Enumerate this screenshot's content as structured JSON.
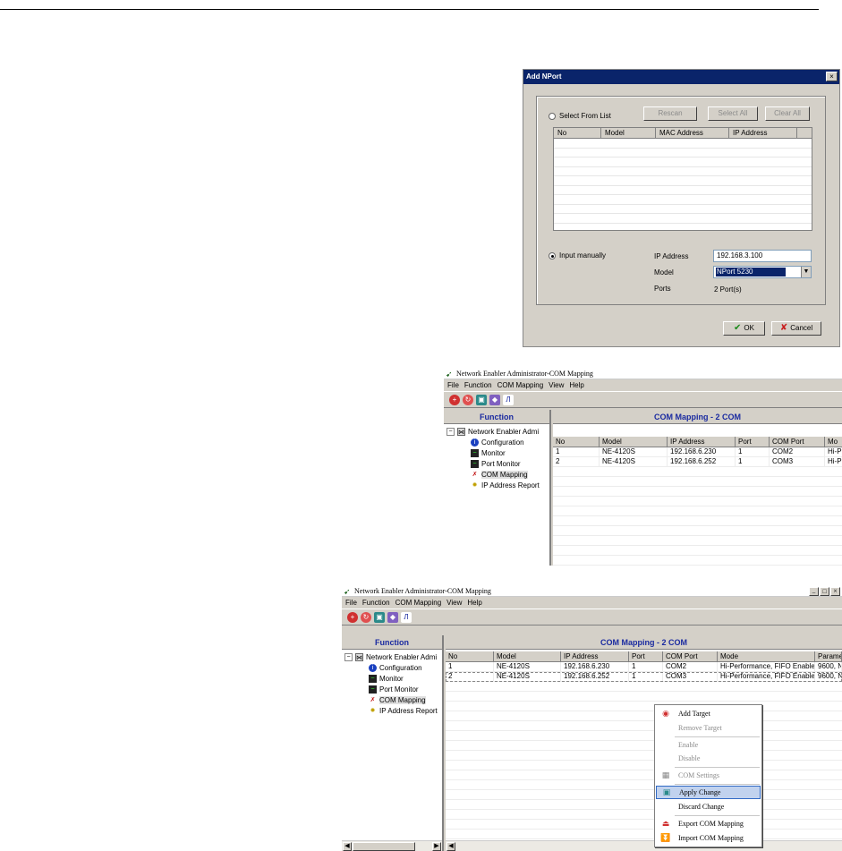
{
  "dialog": {
    "title": "Add NPort",
    "close": "×",
    "select_from_list": "Select From List",
    "rescan": "Rescan",
    "select_all": "Select All",
    "clear_all": "Clear All",
    "columns": [
      "No",
      "Model",
      "MAC Address",
      "IP Address"
    ],
    "input_manually": "Input manually",
    "ip_label": "IP Address",
    "ip_value": "192.168.3.100",
    "model_label": "Model",
    "model_value": "NPort 5230",
    "ports_label": "Ports",
    "ports_value": "2 Port(s)",
    "ok": "OK",
    "cancel": "Cancel"
  },
  "window1": {
    "title": "Network Enabler Administrator-COM Mapping",
    "menu": [
      "File",
      "Function",
      "COM Mapping",
      "View",
      "Help"
    ],
    "function_header": "Function",
    "tree_root": "Network Enabler Admi",
    "tree_items": [
      "Configuration",
      "Monitor",
      "Port Monitor",
      "COM Mapping",
      "IP Address Report"
    ],
    "content_header": "COM Mapping - 2 COM",
    "columns": [
      "No",
      "Model",
      "IP Address",
      "Port",
      "COM Port",
      "Mo"
    ],
    "rows": [
      [
        "1",
        "NE-4120S",
        "192.168.6.230",
        "1",
        "COM2",
        "Hi-P"
      ],
      [
        "2",
        "NE-4120S",
        "192.168.6.252",
        "1",
        "COM3",
        "Hi-P"
      ]
    ]
  },
  "window2": {
    "title": "Network Enabler Administrator-COM Mapping",
    "menu": [
      "File",
      "Function",
      "COM Mapping",
      "View",
      "Help"
    ],
    "function_header": "Function",
    "tree_root": "Network Enabler Admi",
    "tree_items": [
      "Configuration",
      "Monitor",
      "Port Monitor",
      "COM Mapping",
      "IP Address Report"
    ],
    "content_header": "COM Mapping - 2 COM",
    "columns": [
      "No",
      "Model",
      "IP Address",
      "Port",
      "COM Port",
      "Mode",
      "Parame"
    ],
    "rows": [
      [
        "1",
        "NE-4120S",
        "192.168.6.230",
        "1",
        "COM2",
        "Hi-Performance, FIFO Enable",
        "9600, N"
      ],
      [
        "2",
        "NE-4120S",
        "192.168.6.252",
        "1",
        "COM3",
        "Hi-Performance, FIFO Enable",
        "9600, N"
      ]
    ],
    "window_buttons": [
      "_",
      "□",
      "×"
    ]
  },
  "context_menu": {
    "items": [
      {
        "label": "Add Target",
        "enabled": true
      },
      {
        "label": "Remove Target",
        "enabled": false
      },
      {
        "label": "Enable",
        "enabled": false
      },
      {
        "label": "Disable",
        "enabled": false
      },
      {
        "label": "COM Settings",
        "enabled": false
      },
      {
        "label": "Apply Change",
        "enabled": true,
        "highlighted": true
      },
      {
        "label": "Discard Change",
        "enabled": true
      },
      {
        "label": "Export COM Mapping",
        "enabled": true
      },
      {
        "label": "Import COM Mapping",
        "enabled": true
      }
    ]
  },
  "colors": {
    "titlebar": "#0a246a",
    "header_text": "#1a2aa0",
    "highlight": "#c1d2ee"
  }
}
